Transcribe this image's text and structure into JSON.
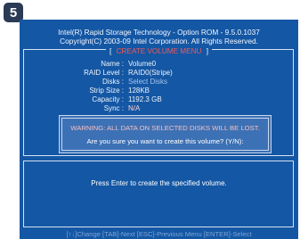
{
  "step_badge": "5",
  "header": {
    "line1": "Intel(R) Rapid Storage Technology - Option ROM - 9.5.0.1037",
    "line2": "Copyright(C) 2003-09 Intel Corporation. All Rights Reserved."
  },
  "menu": {
    "bracket_left": "[",
    "title": "CREATE VOLUME MENU",
    "bracket_right": "]"
  },
  "fields": {
    "name": {
      "label": "Name :",
      "value": "Volume0"
    },
    "raid_level": {
      "label": "RAID Level :",
      "value": "RAID0(Stripe)"
    },
    "disks": {
      "label": "Disks :",
      "value": "Select Disks"
    },
    "strip_size": {
      "label": "Strip Size :",
      "value": "128KB"
    },
    "capacity": {
      "label": "Capacity :",
      "value": "1192.3 GB"
    },
    "sync": {
      "label": "Sync :",
      "value": "N/A"
    }
  },
  "dialog": {
    "warning": "WARNING: ALL DATA ON SELECTED DISKS WILL BE LOST.",
    "confirm": "Are you sure you want to create this volume? (Y/N):"
  },
  "help": {
    "prompt": "Press Enter to create the specified volume."
  },
  "footer": {
    "text": "[↑↓]Change   [TAB]-Next   [ESC]-Previous Menu   [ENTER]-Select"
  }
}
